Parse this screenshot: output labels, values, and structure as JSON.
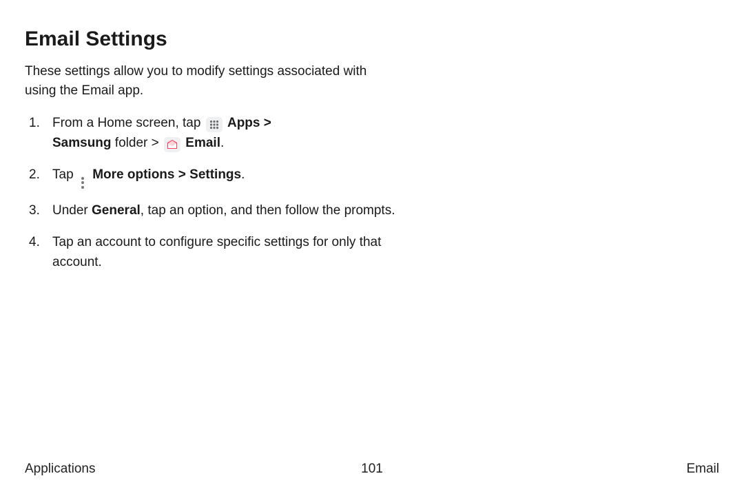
{
  "heading": "Email Settings",
  "intro": "These settings allow you to modify settings associated with using the Email app.",
  "steps": {
    "s1": {
      "a": "From a Home screen, tap ",
      "apps": "Apps",
      "gt1": " > ",
      "samsung": "Samsung",
      "folder_gt": " folder > ",
      "email": "Email",
      "end": "."
    },
    "s2": {
      "a": "Tap ",
      "more": "More options",
      "gt": " > ",
      "settings": "Settings",
      "end": "."
    },
    "s3": {
      "a": "Under ",
      "general": "General",
      "b": ", tap an option, and then follow the prompts."
    },
    "s4": "Tap an account to configure specific settings for only that account."
  },
  "footer": {
    "left": "Applications",
    "page": "101",
    "right": "Email"
  }
}
